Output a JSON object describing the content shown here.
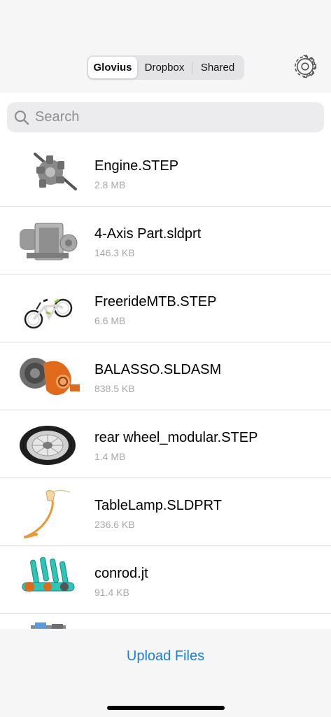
{
  "tabs": [
    {
      "label": "Glovius",
      "active": true
    },
    {
      "label": "Dropbox",
      "active": false
    },
    {
      "label": "Shared",
      "active": false
    }
  ],
  "settings_icon": "gear-icon",
  "search": {
    "placeholder": "Search",
    "icon": "search-icon"
  },
  "files": [
    {
      "name": "Engine.STEP",
      "size": "2.8 MB",
      "thumb": "engine"
    },
    {
      "name": "4-Axis Part.sldprt",
      "size": "146.3 KB",
      "thumb": "part"
    },
    {
      "name": "FreerideMTB.STEP",
      "size": "6.6 MB",
      "thumb": "bike"
    },
    {
      "name": "BALASSO.SLDASM",
      "size": "838.5 KB",
      "thumb": "turbo"
    },
    {
      "name": "rear wheel_modular.STEP",
      "size": "1.4 MB",
      "thumb": "wheel"
    },
    {
      "name": "TableLamp.SLDPRT",
      "size": "236.6 KB",
      "thumb": "lamp"
    },
    {
      "name": "conrod.jt",
      "size": "91.4 KB",
      "thumb": "conrod"
    },
    {
      "name": "",
      "size": "",
      "thumb": "partial"
    }
  ],
  "footer": {
    "upload_label": "Upload Files"
  },
  "colors": {
    "accent": "#1b7fd8",
    "orange": "#e06a1c",
    "teal": "#2ec4b6"
  }
}
